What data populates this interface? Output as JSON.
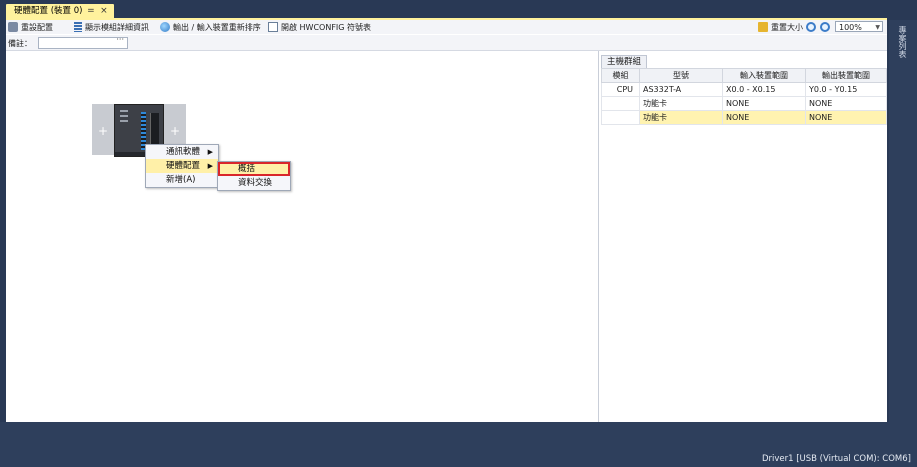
{
  "tab": {
    "title": "硬體配置 (裝置 0)",
    "pin": "=",
    "close": "×"
  },
  "toolbar": {
    "reset_config": "重設配置",
    "show_detail": "顯示模組詳細資訊",
    "io_reorder": "輸出 / 輸入裝置重新排序",
    "hwconfig": "開啟 HWCONFIG 符號表",
    "reset_size": "重置大小",
    "zoom": "100%"
  },
  "note": {
    "label": "備註：",
    "more": "···"
  },
  "context_menu": {
    "items": [
      {
        "label": "通訊軟體"
      },
      {
        "label": "硬體配置"
      },
      {
        "label": "新增(A)"
      }
    ],
    "submenu": [
      {
        "label": "概括"
      },
      {
        "label": "資料交換"
      }
    ]
  },
  "main_panel": {
    "tab": "主機群組",
    "headers": [
      "模組",
      "型號",
      "輸入裝置範圍",
      "輸出裝置範圍"
    ],
    "rows": [
      [
        "CPU",
        "AS332T-A",
        "X0.0 - X0.15",
        "Y0.0 - Y0.15"
      ],
      [
        "",
        "功能卡",
        "NONE",
        "NONE"
      ],
      [
        "",
        "功能卡",
        "NONE",
        "NONE"
      ]
    ]
  },
  "side_panel": {
    "label": "專案列表"
  },
  "status": {
    "text": "Driver1 [USB (Virtual COM): COM6]"
  },
  "slots": {
    "left": "+",
    "right": "+"
  }
}
